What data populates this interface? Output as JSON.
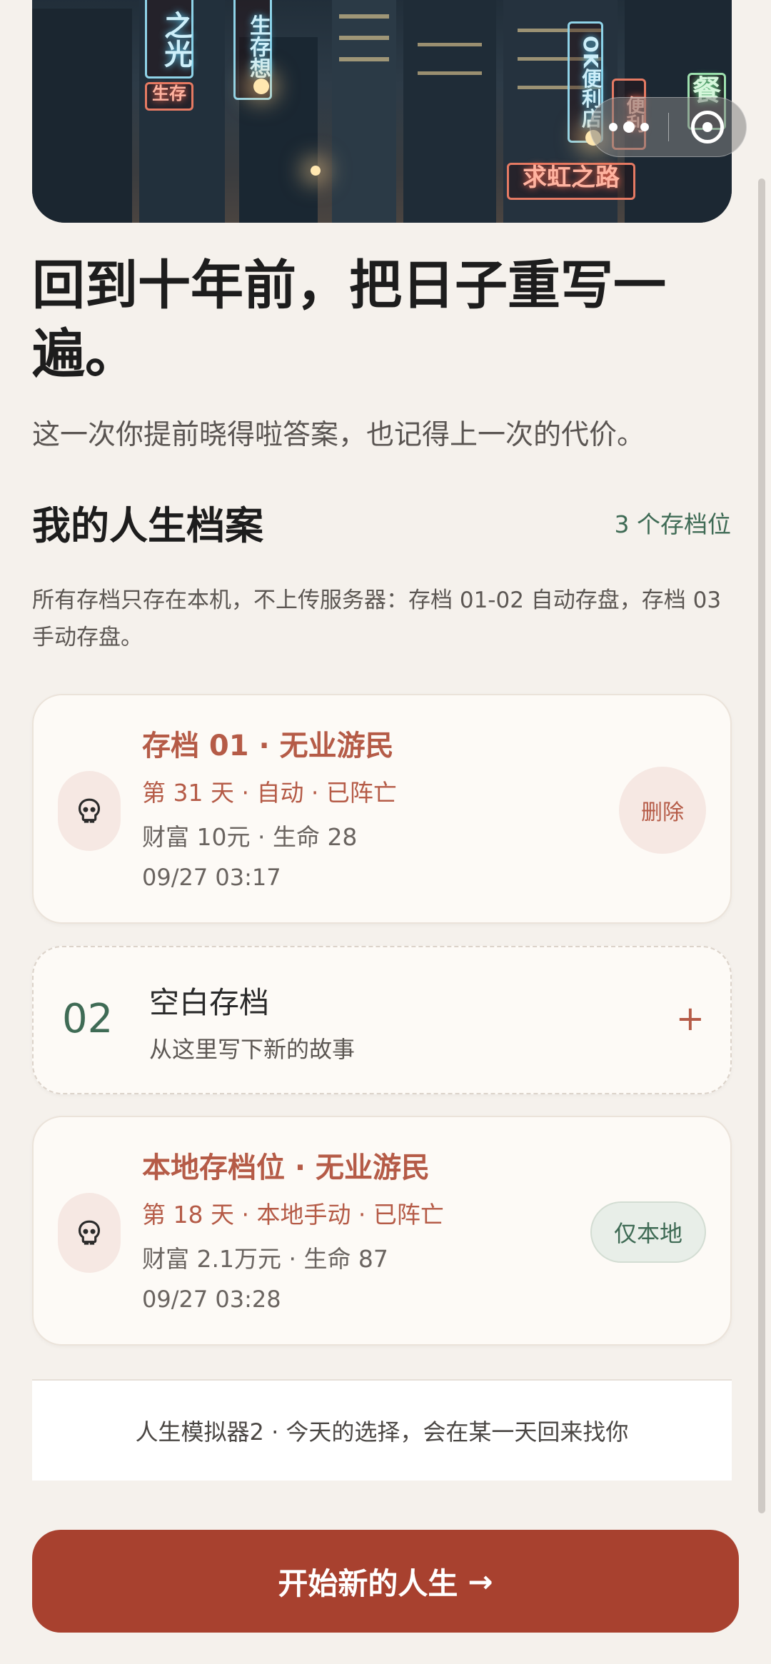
{
  "hero": {
    "signs": [
      "之光",
      "生存",
      "生存想",
      "OK便利店",
      "求虹之路",
      "餐",
      "便利"
    ]
  },
  "capsule": {
    "more_icon": "more-dots-icon",
    "close_icon": "target-close-icon"
  },
  "headline": "回到十年前，把日子重写一遍。",
  "subline": "这一次你提前晓得啦答案，也记得上一次的代价。",
  "section": {
    "title": "我的人生档案",
    "slot_count": "3 个存档位",
    "note": "所有存档只存在本机，不上传服务器：存档 01-02 自动存盘，存档 03 手动存盘。"
  },
  "slots": [
    {
      "icon": "skull-icon",
      "title": "存档 01 · 无业游民",
      "status": "第 31 天 · 自动 · 已阵亡",
      "stats": "财富 10元 · 生命 28",
      "time": "09/27 03:17",
      "action": "删除"
    },
    {
      "number": "02",
      "title": "空白存档",
      "subtitle": "从这里写下新的故事",
      "action": "+"
    },
    {
      "icon": "skull-icon",
      "title": "本地存档位 · 无业游民",
      "status": "第 18 天 · 本地手动 · 已阵亡",
      "stats": "财富 2.1万元 · 生命 87",
      "time": "09/27 03:28",
      "action": "仅本地"
    }
  ],
  "footer": "人生模拟器2 · 今天的选择，会在某一天回来找你",
  "cta": {
    "label": "开始新的人生",
    "arrow": "→"
  },
  "colors": {
    "accent": "#a8412f",
    "accent_text": "#b55b47",
    "green": "#3f6b55",
    "background": "#f5f1ec"
  }
}
